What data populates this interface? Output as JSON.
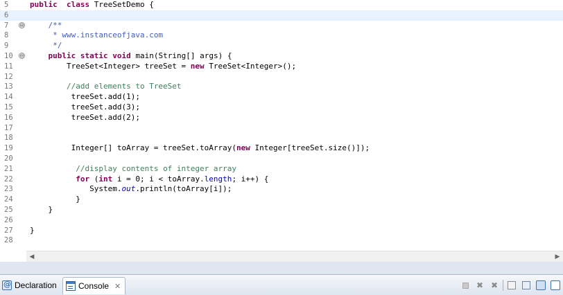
{
  "editor": {
    "lines": [
      {
        "no": "5",
        "segments": [
          [
            "kw",
            "public"
          ],
          [
            "",
            "  "
          ],
          [
            "kw",
            "class"
          ],
          [
            "",
            " TreeSetDemo {"
          ]
        ]
      },
      {
        "no": "6",
        "current": true,
        "segments": []
      },
      {
        "no": "7",
        "fold": "⊖",
        "segments": [
          [
            "",
            "    "
          ],
          [
            "jd",
            "/**"
          ]
        ]
      },
      {
        "no": "8",
        "segments": [
          [
            "",
            "     "
          ],
          [
            "jd",
            "* www.instanceofjava.com"
          ]
        ]
      },
      {
        "no": "9",
        "segments": [
          [
            "",
            "     "
          ],
          [
            "jd",
            "*/"
          ]
        ]
      },
      {
        "no": "10",
        "fold": "⊖",
        "segments": [
          [
            "",
            "    "
          ],
          [
            "kw",
            "public"
          ],
          [
            "",
            " "
          ],
          [
            "kw",
            "static"
          ],
          [
            "",
            " "
          ],
          [
            "kw",
            "void"
          ],
          [
            "",
            " main(String[] args) {"
          ]
        ]
      },
      {
        "no": "11",
        "segments": [
          [
            "",
            "        TreeSet<Integer> treeSet = "
          ],
          [
            "kw",
            "new"
          ],
          [
            "",
            " TreeSet<Integer>();"
          ]
        ]
      },
      {
        "no": "12",
        "segments": []
      },
      {
        "no": "13",
        "segments": [
          [
            "",
            "        "
          ],
          [
            "cm",
            "//add elements to TreeSet"
          ]
        ]
      },
      {
        "no": "14",
        "segments": [
          [
            "",
            "         treeSet.add(1);"
          ]
        ]
      },
      {
        "no": "15",
        "segments": [
          [
            "",
            "         treeSet.add(3);"
          ]
        ]
      },
      {
        "no": "16",
        "segments": [
          [
            "",
            "         treeSet.add(2);"
          ]
        ]
      },
      {
        "no": "17",
        "segments": []
      },
      {
        "no": "18",
        "segments": []
      },
      {
        "no": "19",
        "segments": [
          [
            "",
            "         Integer[] toArray = treeSet.toArray("
          ],
          [
            "kw",
            "new"
          ],
          [
            "",
            " Integer[treeSet.size()]);"
          ]
        ]
      },
      {
        "no": "20",
        "segments": []
      },
      {
        "no": "21",
        "segments": [
          [
            "",
            "          "
          ],
          [
            "cm",
            "//display contents of integer array"
          ]
        ]
      },
      {
        "no": "22",
        "segments": [
          [
            "",
            "          "
          ],
          [
            "kw",
            "for"
          ],
          [
            "",
            " ("
          ],
          [
            "kw",
            "int"
          ],
          [
            "",
            " i = 0; i < toArray."
          ],
          [
            "fld",
            "length"
          ],
          [
            "",
            "; i++) {"
          ]
        ]
      },
      {
        "no": "23",
        "segments": [
          [
            "",
            "             System."
          ],
          [
            "st",
            "out"
          ],
          [
            "",
            ".println(toArray[i]);"
          ]
        ]
      },
      {
        "no": "24",
        "segments": [
          [
            "",
            "          }"
          ]
        ]
      },
      {
        "no": "25",
        "segments": [
          [
            "",
            "    }"
          ]
        ]
      },
      {
        "no": "26",
        "segments": []
      },
      {
        "no": "27",
        "segments": [
          [
            "",
            "}"
          ]
        ]
      },
      {
        "no": "28",
        "segments": []
      }
    ]
  },
  "scrollbar": {
    "left_arrow": "◀",
    "right_arrow": "▶"
  },
  "views": {
    "declaration_label": "Declaration",
    "console_label": "Console",
    "close_glyph": "✕"
  },
  "toolbar": {
    "remove_glyph": "✖",
    "remove_all_glyph": "✖"
  }
}
